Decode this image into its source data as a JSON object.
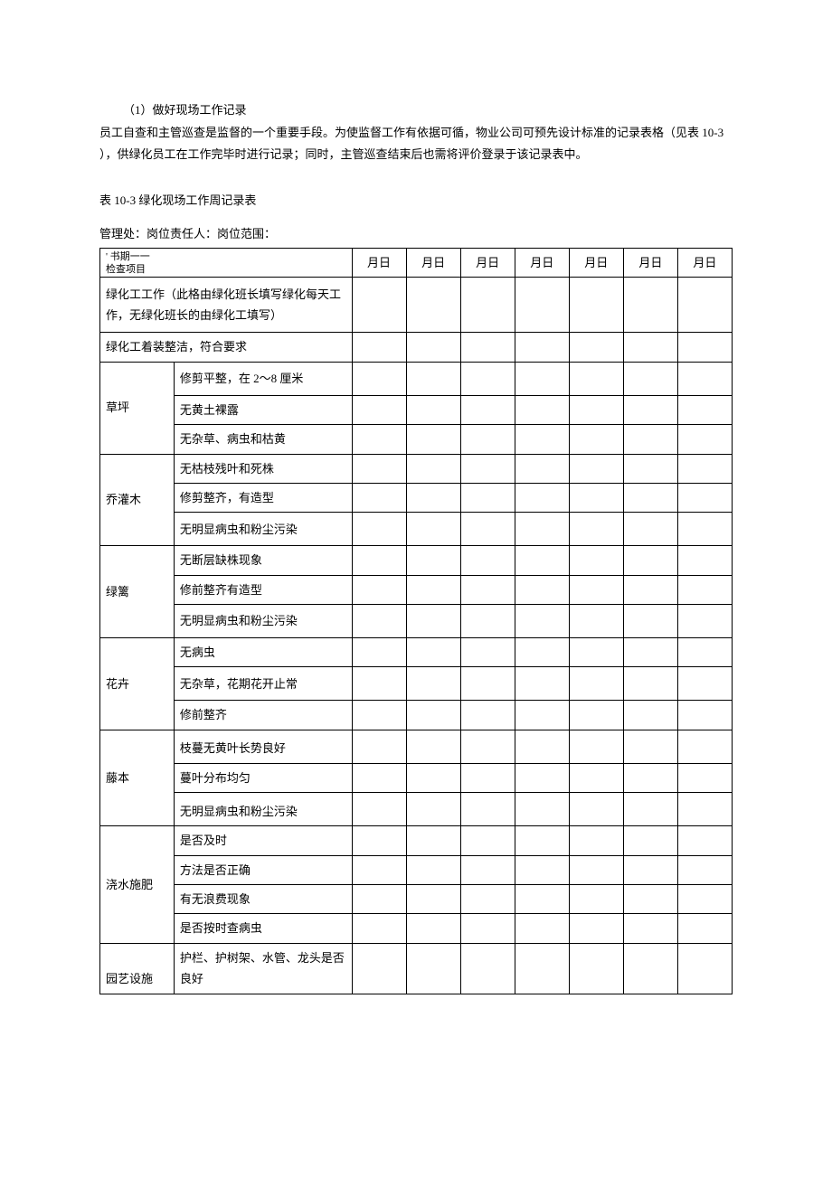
{
  "intro": {
    "p1": "（1）做好现场工作记录",
    "p2": "员工自查和主管巡查是监督的一个重要手段。为使监督工作有依据可循，物业公司可预先设计标准的记录表格（见表 10-3 ），供绿化员工在工作完毕时进行记录；同时，主管巡查结束后也需将评价登录于该记录表中。"
  },
  "table_title": "表 10-3 绿化现场工作周记录表",
  "meta": "管理处：岗位责任人：岗位范围：",
  "header": {
    "book_period": "' 书期一一",
    "check_item": "检查项目",
    "day": "月日"
  },
  "rows": {
    "r1": "绿化工工作（此格由绿化班长填写绿化每天工作，无绿化班长的由绿化工填写）",
    "r2": "绿化工着装整洁，符合要求",
    "g_lawn": "草坪",
    "lawn_1": "修剪平整，在 2～8 厘米",
    "lawn_2": "无黄土裸露",
    "lawn_3": "无杂草、病虫和枯黄",
    "g_tree": "乔灌木",
    "tree_1": "无枯枝残叶和死株",
    "tree_2": "修剪整齐，有造型",
    "tree_3": "无明显病虫和粉尘污染",
    "g_hedge": "绿篱",
    "hedge_1": "无断层缺株现象",
    "hedge_2": "修前整齐有造型",
    "hedge_3": "无明显病虫和粉尘污染",
    "g_flower": "花卉",
    "flower_1": "无病虫",
    "flower_2": "无杂草，花期花开止常",
    "flower_3": "修前整齐",
    "g_vine": "藤本",
    "vine_1": "枝蔓无黄叶长势良好",
    "vine_2": "蔓叶分布均匀",
    "vine_3": "无明显病虫和粉尘污染",
    "g_water": "浇水施肥",
    "water_1": "是否及时",
    "water_2": "方法是否正确",
    "water_3": "有无浪费现象",
    "water_4": "是否按时查病虫",
    "g_facility": "园艺设施",
    "facility_1": "护栏、护树架、水管、龙头是否良好"
  }
}
